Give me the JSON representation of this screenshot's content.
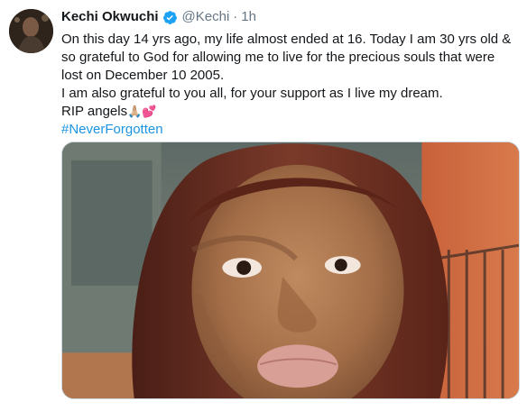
{
  "tweet": {
    "author_name": "Kechi Okwuchi",
    "handle": "@Kechi",
    "separator": "·",
    "time": "1h",
    "lines": [
      "On this day 14 yrs ago, my life almost ended at 16. Today I am 30 yrs old &",
      "so grateful to God for allowing me to live for the precious souls that were",
      "lost on December 10 2005.",
      "I am also grateful to you all, for your support as I live my dream."
    ],
    "rip_text": "RIP angels",
    "rip_emoji": "🙏🏼💕",
    "hashtag": "#NeverForgotten"
  },
  "icons": {
    "verified": "verified-badge-icon"
  },
  "colors": {
    "name": "#14171a",
    "muted": "#657786",
    "link": "#1b95e0",
    "verified": "#1da1f2"
  }
}
